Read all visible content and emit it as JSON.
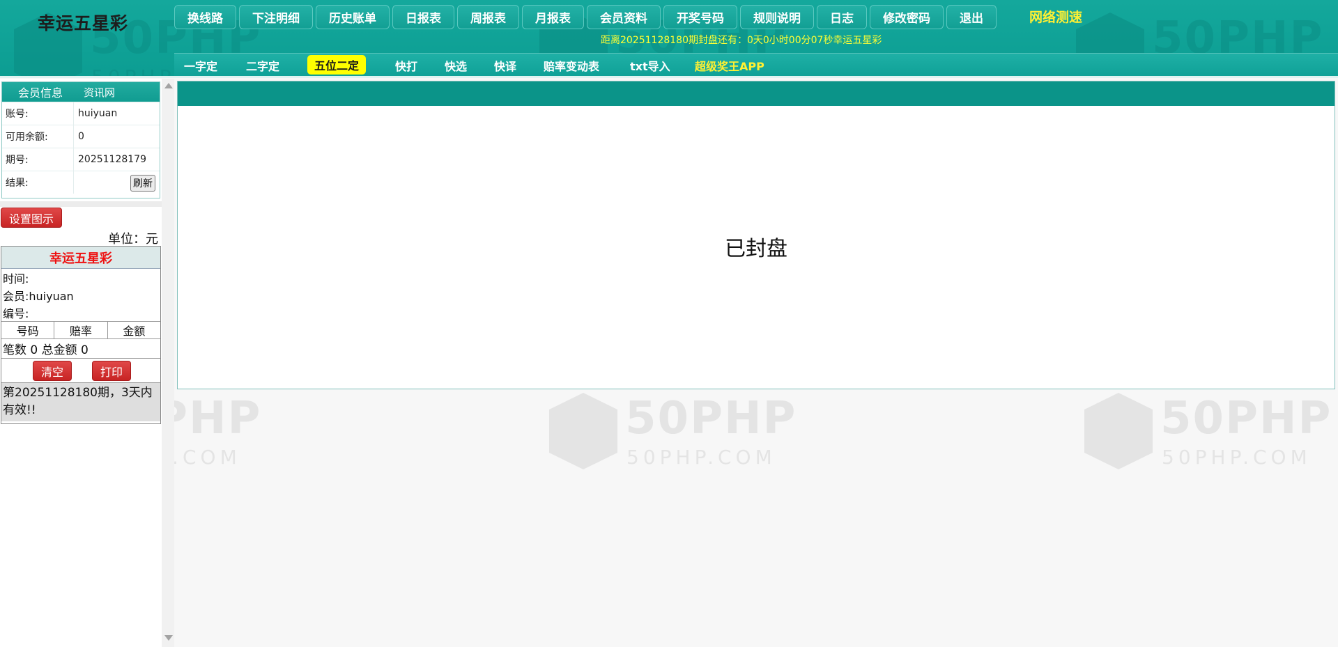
{
  "header": {
    "logo": "幸运五星彩",
    "nav": [
      "换线路",
      "下注明细",
      "历史账单",
      "日报表",
      "周报表",
      "月报表",
      "会员资料",
      "开奖号码",
      "规则说明",
      "日志",
      "修改密码",
      "退出"
    ],
    "speed_test": "网络测速",
    "countdown": "距离20251128180期封盘还有：0天0小时00分07秒幸运五星彩"
  },
  "subnav": {
    "items": [
      "一字定",
      "二字定",
      "五位二定",
      "快打",
      "快选",
      "快译",
      "赔率变动表",
      "txt导入",
      "超级奖王APP"
    ],
    "active": "五位二定",
    "highlight": "超级奖王APP"
  },
  "member": {
    "tabs": [
      "会员信息",
      "资讯网"
    ],
    "rows": [
      {
        "label": "账号:",
        "value": "huiyuan"
      },
      {
        "label": "可用余额:",
        "value": "0"
      },
      {
        "label": "期号:",
        "value": "20251128179"
      },
      {
        "label": "结果:",
        "value": ""
      }
    ],
    "refresh_label": "刷新"
  },
  "settings_button": "设置图示",
  "unit": "单位：元",
  "ticket": {
    "title": "幸运五星彩",
    "time_label": "时间:",
    "member_label": "会员:huiyuan",
    "id_label": "编号:",
    "columns": [
      "号码",
      "赔率",
      "金额"
    ],
    "summary": "笔数 0 总金额 0",
    "clear_label": "清空",
    "print_label": "打印",
    "note": "第20251128180期，3天内有效!!"
  },
  "main": {
    "status": "已封盘"
  },
  "watermark": {
    "big": "50PHP",
    "small": "50PHP.COM"
  },
  "colors": {
    "header_bg": "#0fa095",
    "active_tab": "#ffff00",
    "highlight_text": "#fff033",
    "danger": "#d03030"
  }
}
